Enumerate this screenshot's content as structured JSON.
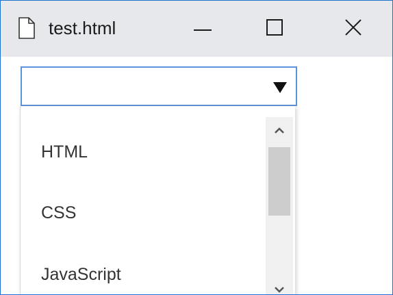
{
  "window": {
    "title": "test.html",
    "icons": {
      "document": "document-icon",
      "minimize": "minimize-icon",
      "maximize": "maximize-icon",
      "close": "close-icon"
    }
  },
  "select": {
    "value": "",
    "arrow_icon": "dropdown-arrow-icon",
    "options": [
      "HTML",
      "CSS",
      "JavaScript"
    ]
  },
  "scrollbar": {
    "up_icon": "chevron-up-icon",
    "down_icon": "chevron-down-icon"
  },
  "colors": {
    "accent": "#5b93d8",
    "window_border": "#1e6fd0",
    "titlebar_bg": "#e6e8ec",
    "scrollbar_track": "#f0f0f0",
    "scrollbar_thumb": "#cdcdcd"
  }
}
